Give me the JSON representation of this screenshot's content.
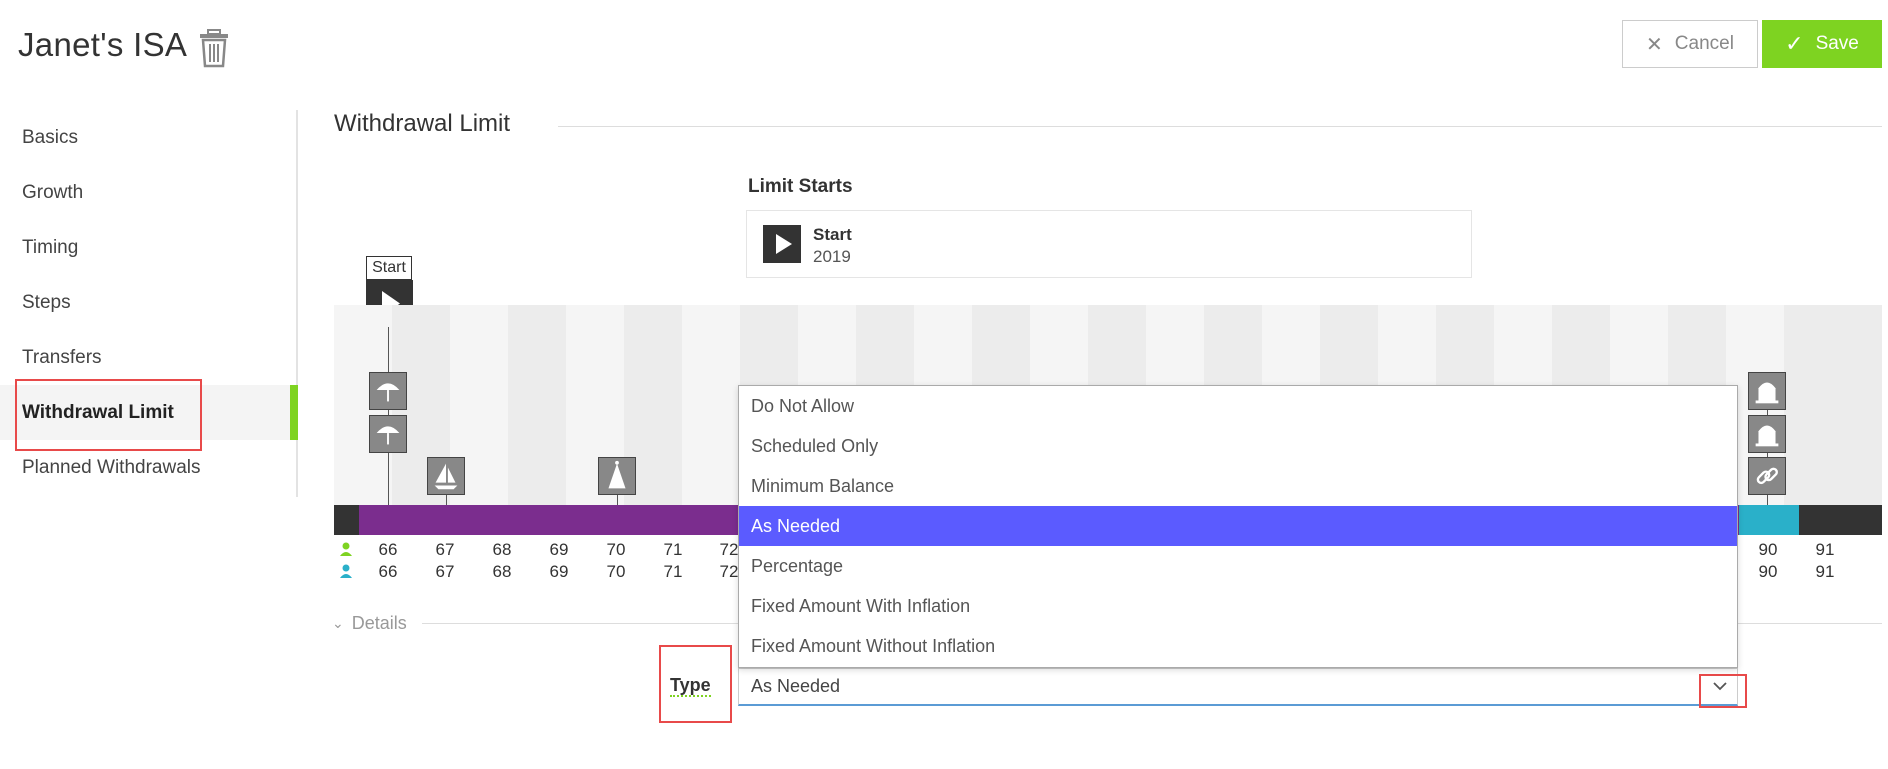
{
  "header": {
    "title": "Janet's ISA",
    "cancel_label": "Cancel",
    "save_label": "Save"
  },
  "sidebar": {
    "items": [
      {
        "label": "Basics"
      },
      {
        "label": "Growth"
      },
      {
        "label": "Timing"
      },
      {
        "label": "Steps"
      },
      {
        "label": "Transfers"
      },
      {
        "label": "Withdrawal Limit"
      },
      {
        "label": "Planned Withdrawals"
      }
    ]
  },
  "section": {
    "title": "Withdrawal Limit",
    "limit_starts_label": "Limit Starts",
    "limit_start": {
      "name": "Start",
      "year": "2019"
    }
  },
  "timeline": {
    "start_flag": "Start",
    "ages_row1": [
      "66",
      "67",
      "68",
      "69",
      "70",
      "71",
      "72",
      "90",
      "91"
    ],
    "ages_row2": [
      "66",
      "67",
      "68",
      "69",
      "70",
      "71",
      "72",
      "90",
      "91"
    ],
    "colors": {
      "purple": "#7b2d8e",
      "teal": "#2ab0c9",
      "dark": "#333333",
      "green": "#7ed321"
    }
  },
  "details": {
    "label": "Details"
  },
  "type_field": {
    "label": "Type",
    "value": "As Needed",
    "options": [
      "Do Not Allow",
      "Scheduled Only",
      "Minimum Balance",
      "As Needed",
      "Percentage",
      "Fixed Amount With Inflation",
      "Fixed Amount Without Inflation"
    ],
    "selected_index": 3
  }
}
